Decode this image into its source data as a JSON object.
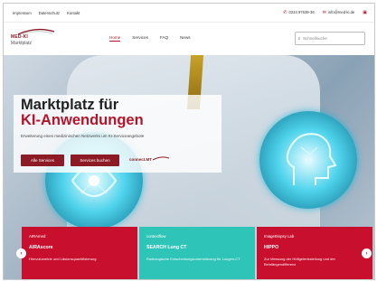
{
  "topbar": {
    "links": [
      "Impressum",
      "Datenschutz",
      "Kontakt"
    ],
    "phone": "0234 97639-36",
    "email": "info@med-ki.de"
  },
  "logo": {
    "brand": "MED-KI",
    "subtitle": "Marktplatz"
  },
  "nav": {
    "items": [
      "Home",
      "Services",
      "FAQ",
      "News"
    ]
  },
  "search": {
    "placeholder": "Schnellsuche"
  },
  "hero": {
    "title_line1": "Marktplatz für",
    "title_line2": "KI-Anwendungen",
    "subtitle": "Erweiterung eines medizinischen Netzwerks um KI-Serviceangebote",
    "buttons": [
      "Alle Services",
      "Services buchen"
    ],
    "connect_label": "connect.MT"
  },
  "cards": [
    {
      "name": "AIRAmed",
      "title": "AIRAscore",
      "desc": "Hirnvolumetrie und Läsionsquantifizierung",
      "color": "#c8102e"
    },
    {
      "name": "contextflow",
      "title": "SEARCH Lung CT",
      "desc": "Radiologische Entscheidungsunterstützung für Lungen-CT",
      "color": "#2fc4b8"
    },
    {
      "name": "ImageBiopsy Lab",
      "title": "HIPPO",
      "desc": "Zur Messung der Hüftgelenkstellung und der Beinlängendifferenz",
      "color": "#c8102e"
    }
  ],
  "icons": {
    "prev": "chevron-left-icon",
    "next": "chevron-right-icon",
    "search": "search-icon"
  }
}
